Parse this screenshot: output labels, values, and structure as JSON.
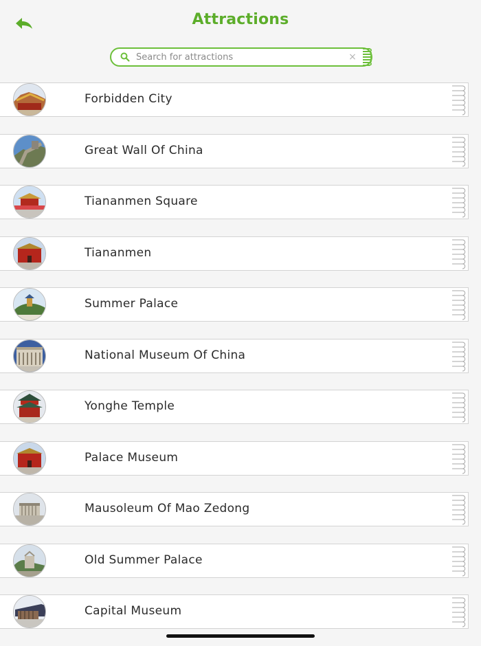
{
  "header": {
    "title": "Attractions",
    "back_icon": "back-arrow-icon",
    "accent_color": "#5cad2a"
  },
  "search": {
    "placeholder": "Search for attractions",
    "value": "",
    "clear_label": "×"
  },
  "attractions": [
    {
      "name": "Forbidden City",
      "thumb": "palace-rooftops"
    },
    {
      "name": "Great Wall Of China",
      "thumb": "great-wall"
    },
    {
      "name": "Tiananmen Square",
      "thumb": "gate-plaza"
    },
    {
      "name": "Tiananmen",
      "thumb": "red-gate"
    },
    {
      "name": "Summer Palace",
      "thumb": "hill-pagoda"
    },
    {
      "name": "National Museum Of China",
      "thumb": "museum-facade"
    },
    {
      "name": "Yonghe Temple",
      "thumb": "temple"
    },
    {
      "name": "Palace Museum",
      "thumb": "red-gate"
    },
    {
      "name": "Mausoleum Of Mao Zedong",
      "thumb": "mausoleum"
    },
    {
      "name": "Old Summer Palace",
      "thumb": "ruins"
    },
    {
      "name": "Capital Museum",
      "thumb": "modern-building"
    }
  ]
}
